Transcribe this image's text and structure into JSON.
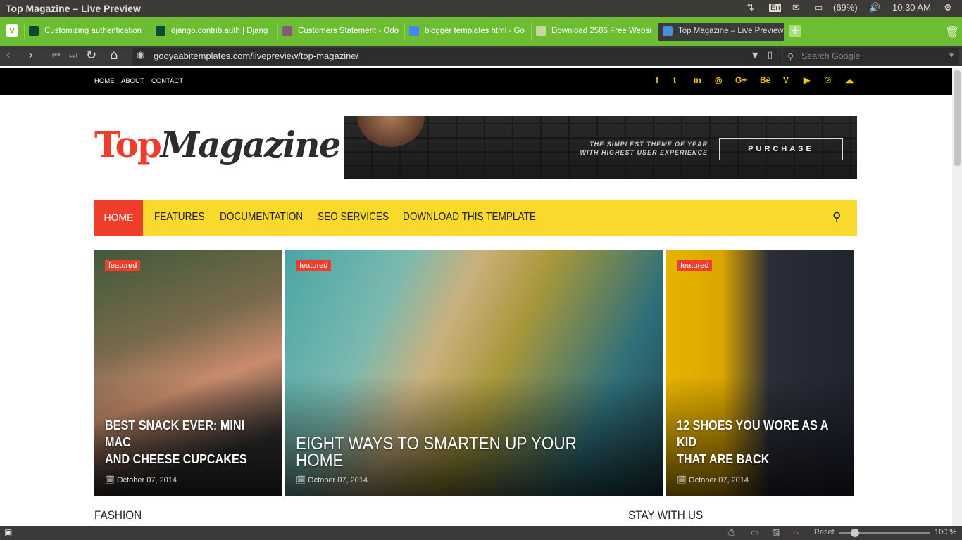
{
  "os": {
    "window_title": "Top Magazine – Live Preview",
    "lang": "En",
    "battery": "(69%)",
    "time": "10:30 AM"
  },
  "tabs": [
    {
      "label": "Customizing authentication",
      "fav_color": "#0c4b33"
    },
    {
      "label": "django.contrib.auth | Djang",
      "fav_color": "#0c4b33"
    },
    {
      "label": "Customers Statement - Odo",
      "fav_color": "#875a7b"
    },
    {
      "label": "blogger templates html - Go",
      "fav_color": "#4285f4"
    },
    {
      "label": "Download 2586 Free Websi",
      "fav_color": "#c8d6a0"
    },
    {
      "label": "Top Magazine – Live Preview",
      "fav_color": "#4a90d9"
    }
  ],
  "browser": {
    "url": "gooyaabitemplates.com/livepreview/top-magazine/",
    "search_placeholder": "Search Google",
    "reset_label": "Reset",
    "zoom": "100 %"
  },
  "site": {
    "top_links": [
      "HOME",
      "ABOUT",
      "CONTACT"
    ],
    "social_icons": [
      "facebook-icon",
      "twitter-icon",
      "linkedin-icon",
      "instagram-icon",
      "google-plus-icon",
      "behance-icon",
      "vine-icon",
      "youtube-icon",
      "pinterest-icon",
      "soundcloud-icon"
    ],
    "social_glyphs": [
      "f",
      "t",
      "in",
      "◎",
      "G+",
      "Bē",
      "V",
      "▶",
      "℗",
      "☁"
    ],
    "logo_top": "Top",
    "logo_mag": "Magazine",
    "banner": {
      "tagline_1": "THE SIMPLEST THEME OF YEAR",
      "tagline_2": "WITH HIGHEST USER EXPERIENCE",
      "button": "PURCHASE"
    },
    "nav": [
      "HOME",
      "FEATURES",
      "DOCUMENTATION",
      "SEO SERVICES",
      "DOWNLOAD THIS TEMPLATE"
    ],
    "accent": "#f03d2b",
    "nav_bg": "#f8d92c",
    "cards": [
      {
        "badge": "featured",
        "title_1": "BEST SNACK EVER: MINI MAC",
        "title_2": "AND CHEESE CUPCAKES",
        "date": "October 07, 2014"
      },
      {
        "badge": "featured",
        "title_1": "EIGHT WAYS TO SMARTEN UP YOUR HOME",
        "title_2": "",
        "date": "October 07, 2014"
      },
      {
        "badge": "featured",
        "title_1": "12 SHOES YOU WORE AS A KID",
        "title_2": "THAT ARE BACK",
        "date": "October 07, 2014"
      }
    ],
    "section_left": "FASHION",
    "section_right": "STAY WITH US"
  }
}
